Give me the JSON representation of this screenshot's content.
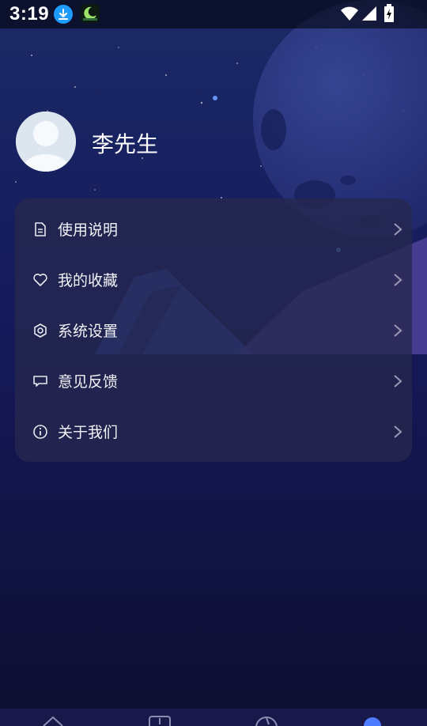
{
  "status_bar": {
    "time": "3:19",
    "icons": [
      "download-notification-icon",
      "moon-app-icon",
      "wifi-icon",
      "cell-signal-icon",
      "battery-charging-icon"
    ]
  },
  "profile": {
    "name": "李先生",
    "avatar_icon": "default-avatar-icon"
  },
  "menu": {
    "items": [
      {
        "label": "使用说明",
        "icon": "document-icon"
      },
      {
        "label": "我的收藏",
        "icon": "heart-icon"
      },
      {
        "label": "系统设置",
        "icon": "settings-icon"
      },
      {
        "label": "意见反馈",
        "icon": "feedback-icon"
      },
      {
        "label": "关于我们",
        "icon": "info-icon"
      }
    ]
  },
  "bottom_nav": {
    "tabs": [
      {
        "icon": "home-icon"
      },
      {
        "icon": "add-icon"
      },
      {
        "icon": "music-icon"
      },
      {
        "icon": "profile-icon",
        "active": true
      }
    ]
  },
  "colors": {
    "background": "#0f1033",
    "card": "#26284e",
    "text": "#f2f2f6",
    "active_tab": "#4f7cff"
  }
}
